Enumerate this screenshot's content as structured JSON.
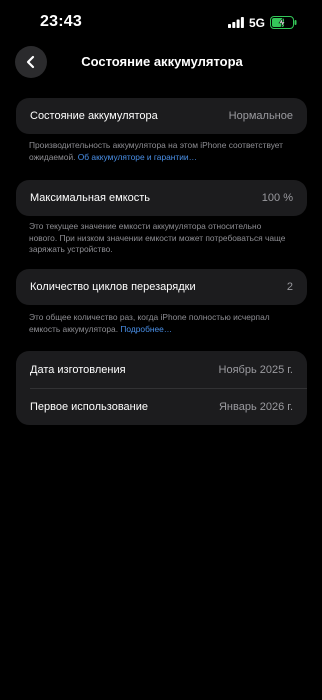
{
  "status_bar": {
    "time": "23:43",
    "network": "5G",
    "battery_level": 0.6,
    "battery_charging": true,
    "battery_color": "#34c759"
  },
  "nav": {
    "back_icon": "chevron-left-icon",
    "title": "Состояние аккумулятора"
  },
  "battery_health": {
    "label": "Состояние аккумулятора",
    "value": "Нормальное",
    "footnote_text": "Производительность аккумулятора на этом iPhone соответствует ожидаемой.",
    "footnote_link": "Об аккумуляторе и гарантии…"
  },
  "max_capacity": {
    "label": "Максимальная емкость",
    "value": "100 %",
    "footnote_text": "Это текущее значение емкости аккумулятора относительно нового. При низком значении емкости может потребоваться чаще заряжать устройство."
  },
  "cycle_count": {
    "label": "Количество циклов перезарядки",
    "value": "2",
    "footnote_text": "Это общее количество раз, когда iPhone полностью исчерпал емкость аккумулятора.",
    "footnote_link": "Подробнее…"
  },
  "dates": {
    "manufacture_label": "Дата изготовления",
    "manufacture_value": "Ноябрь 2025 г.",
    "first_use_label": "Первое использование",
    "first_use_value": "Январь 2026 г."
  },
  "colors": {
    "background": "#000000",
    "card": "#1c1c1e",
    "secondary_text": "#9a9a9f",
    "link": "#4a90e8"
  }
}
